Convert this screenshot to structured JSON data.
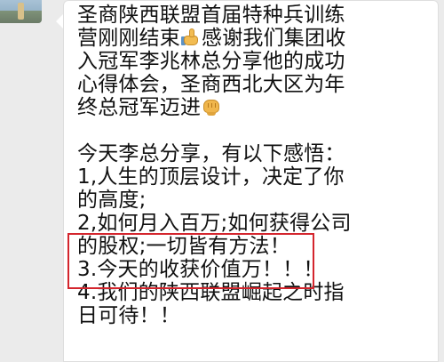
{
  "chat": {
    "message_lines": [
      "圣商陕西联盟首届特种兵训练",
      "营刚刚结束",
      "感谢我们集团收",
      "入冠军李兆林总分享他的成功",
      "心得体会，圣商西北大区为年",
      "终总冠军迈进",
      "今天李总分享，有以下感悟：",
      "1,人生的顶层设计，决定了你",
      "的高度;",
      "2,如何月入百万;如何获得公司",
      "的股权;一切皆有方法！",
      "3.今天的收获价值万！！！",
      "4.我们的陕西联盟崛起之时指",
      "日可待！！"
    ],
    "icons": {
      "thumbs_up": "thumbs-up-icon",
      "fist": "fist-icon"
    },
    "highlight_color": "#d4252d"
  }
}
